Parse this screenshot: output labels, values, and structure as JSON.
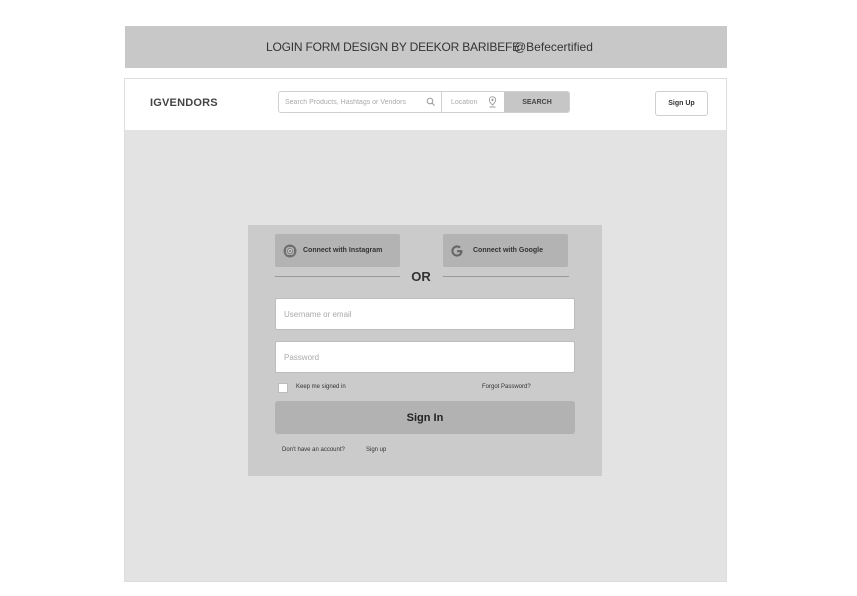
{
  "banner": {
    "title": "LOGIN FORM DESIGN BY DEEKOR BARIBEFE",
    "handle": "@Befecertified"
  },
  "navbar": {
    "logo": "IGVENDORS",
    "search_placeholder": "Search Products, Hashtags or Vendors",
    "location_placeholder": "Location",
    "search_button": "SEARCH",
    "signup_button": "Sign Up"
  },
  "login": {
    "instagram_button": "Connect with Instagram",
    "google_button": "Connect with Google",
    "or_text": "OR",
    "username_placeholder": "Username or email",
    "password_placeholder": "Password",
    "keep_signed_in": "Keep me signed in",
    "forgot_password": "Forgot Password?",
    "signin_button": "Sign In",
    "no_account_text": "Don't have an account?",
    "signup_link": "Sign up"
  },
  "colors": {
    "banner_bg": "#c8c8c8",
    "page_bg": "#e3e3e3",
    "card_bg": "#cbcbcb",
    "button_bg": "#b2b2b2"
  },
  "icons": {
    "search": "search-icon",
    "location": "location-pin-icon",
    "instagram": "instagram-icon",
    "google": "google-icon"
  }
}
